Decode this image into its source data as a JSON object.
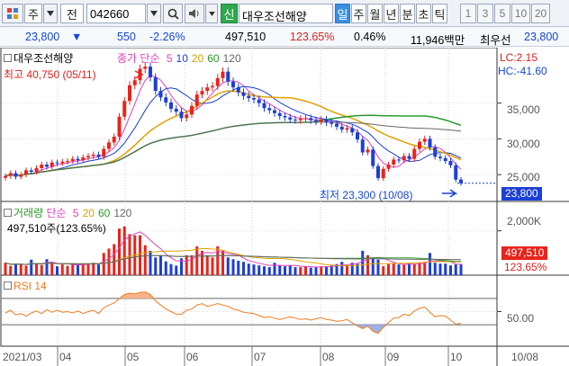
{
  "toolbar": {
    "menu_label": "주",
    "type_label": "전",
    "stock_code": "042660",
    "flag_label": "신",
    "stock_name": "대우조선해양",
    "periods": [
      {
        "label": "일",
        "selected": true
      },
      {
        "label": "주",
        "selected": false
      },
      {
        "label": "월",
        "selected": false
      },
      {
        "label": "년",
        "selected": false
      },
      {
        "label": "분",
        "selected": false
      },
      {
        "label": "초",
        "selected": false
      },
      {
        "label": "틱",
        "selected": false
      }
    ],
    "intervals": [
      "1",
      "3",
      "5",
      "10",
      "20"
    ]
  },
  "quote": {
    "price": "23,800",
    "change": "550",
    "change_rate": "-2.26%",
    "volume": "497,510",
    "volume_ratio": "123.65%",
    "turnover": "0.46%",
    "amount": "11,946백만",
    "best_label": "최우선",
    "best_price": "23,800"
  },
  "price_panel": {
    "title": "대우조선해양",
    "ma_label": "종가 단순",
    "ma_periods": [
      "5",
      "10",
      "20",
      "60",
      "120"
    ],
    "ma_colors": [
      "#e040c0",
      "#1a3fd0",
      "#e0a000",
      "#2a9a2a",
      "#666666"
    ],
    "high_label": "최고 40,750 (05/11)",
    "low_label": "최저 23,300 (10/08)",
    "lc_label": "LC:2.15",
    "hc_label": "HC:-41.60",
    "y_ticks": [
      "35,000",
      "30,000",
      "25,000"
    ],
    "current_tag": "23,800"
  },
  "volume_panel": {
    "title": "거래량",
    "ma_label": "단순",
    "ma_periods": [
      "5",
      "20",
      "60",
      "120"
    ],
    "value_label": "497,510주(123.65%)",
    "y_tick": "2,000K",
    "current_tag": "497,510",
    "current_ratio": "123.65%"
  },
  "rsi_panel": {
    "title": "RSI 14",
    "y_tick": "50.00"
  },
  "x_axis": {
    "labels": [
      "2021/03",
      "04",
      "05",
      "06",
      "07",
      "08",
      "09",
      "10"
    ],
    "right_label": "10/08"
  },
  "colors": {
    "up": "#e8241c",
    "down": "#1c3fd6",
    "rsi_line": "#f07a1e",
    "rsi_fill": "#f7b48a",
    "rsi_fill_low": "#9fb0e6",
    "current_tag_bg": "#1c3fd6",
    "volume_tag_bg": "#e8241c",
    "accent_select": "#3a8fe0"
  },
  "chart_data": [
    {
      "type": "candlestick",
      "title": "대우조선해양",
      "ylim": [
        22000,
        42000
      ],
      "series": [
        {
          "name": "종가",
          "values": [
            24800,
            25200,
            24700,
            25000,
            25600,
            25400,
            25900,
            26400,
            26100,
            26700,
            26600,
            26800,
            26900,
            27200,
            27000,
            27400,
            27600,
            27800,
            27500,
            28600,
            29500,
            30300,
            33100,
            35300,
            37500,
            38200,
            39800,
            40100,
            38600,
            36700,
            35800,
            35100,
            34200,
            33800,
            32900,
            33400,
            34600,
            36200,
            36700,
            37200,
            37400,
            38500,
            39400,
            38000,
            37200,
            36500,
            36000,
            35700,
            35500,
            35000,
            34300,
            34000,
            33600,
            33200,
            33000,
            32700,
            32600,
            32800,
            32900,
            32600,
            32400,
            32700,
            32300,
            32100,
            31700,
            31300,
            31500,
            30900,
            29900,
            28100,
            28500,
            26200,
            24500,
            25800,
            26400,
            27100,
            27000,
            27600,
            27200,
            28600,
            29600,
            30000,
            28800,
            27500,
            27300,
            26900,
            26300,
            24300,
            23800
          ]
        },
        {
          "name": "5",
          "values": []
        },
        {
          "name": "10",
          "values": []
        },
        {
          "name": "20",
          "values": []
        },
        {
          "name": "60",
          "values": []
        },
        {
          "name": "120",
          "values": []
        }
      ]
    },
    {
      "type": "bar",
      "title": "거래량",
      "ylim": [
        0,
        3000000
      ],
      "series": [
        {
          "name": "거래량",
          "values": [
            560000,
            420000,
            520000,
            480000,
            430000,
            700000,
            510000,
            460000,
            720000,
            560000,
            400000,
            480000,
            420000,
            520000,
            480000,
            520000,
            520000,
            560000,
            480000,
            1000000,
            1200000,
            1400000,
            2100000,
            2200000,
            1850000,
            1800000,
            1800000,
            1350000,
            1100000,
            800000,
            900000,
            620000,
            500000,
            430000,
            760000,
            900000,
            900000,
            1300000,
            1100000,
            900000,
            800000,
            1300000,
            1100000,
            800000,
            720000,
            650000,
            600000,
            520000,
            480000,
            440000,
            400000,
            360000,
            560000,
            440000,
            400000,
            440000,
            360000,
            360000,
            400000,
            340000,
            360000,
            400000,
            400000,
            430000,
            500000,
            600000,
            430000,
            560000,
            520000,
            1100000,
            900000,
            800000,
            700000,
            400000,
            500000,
            520000,
            480000,
            480000,
            520000,
            500000,
            560000,
            600000,
            1000000,
            560000,
            520000,
            520000,
            440000,
            480000,
            497510
          ]
        }
      ]
    },
    {
      "type": "line",
      "title": "RSI 14",
      "ylim": [
        0,
        100
      ],
      "series": [
        {
          "name": "RSI",
          "values": [
            48,
            52,
            45,
            47,
            43,
            48,
            51,
            47,
            53,
            49,
            52,
            49,
            50,
            48,
            51,
            47,
            50,
            52,
            47,
            56,
            60,
            63,
            70,
            76,
            78,
            77,
            79,
            80,
            76,
            66,
            60,
            54,
            50,
            46,
            46,
            52,
            54,
            60,
            62,
            58,
            60,
            62,
            60,
            58,
            54,
            52,
            49,
            48,
            47,
            44,
            41,
            42,
            40,
            38,
            40,
            42,
            40,
            38,
            39,
            37,
            39,
            41,
            38,
            37,
            35,
            36,
            38,
            33,
            28,
            24,
            28,
            20,
            17,
            26,
            33,
            40,
            41,
            46,
            44,
            51,
            55,
            57,
            49,
            42,
            44,
            43,
            37,
            31,
            32
          ]
        }
      ]
    }
  ]
}
